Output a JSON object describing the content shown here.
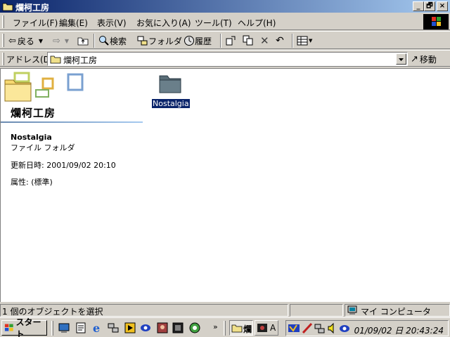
{
  "window": {
    "title": "爛柯工房"
  },
  "caption_buttons": {
    "minimize": "_",
    "maximize": "🗗",
    "close": "×"
  },
  "menu": [
    "ファイル(F)",
    "編集(E)",
    "表示(V)",
    "お気に入り(A)",
    "ツール(T)",
    "ヘルプ(H)"
  ],
  "toolbar": {
    "back_label": "戻る",
    "search_label": "検索",
    "folders_label": "フォルダ",
    "history_label": "履歴"
  },
  "address": {
    "label": "アドレス(D)",
    "value": "爛柯工房",
    "go_label": "移動"
  },
  "web_panel": {
    "title": "爛柯工房",
    "selected_name": "Nostalgia",
    "selected_type": "ファイル フォルダ",
    "modified": "更新日時: 2001/09/02 20:10",
    "attributes": "属性: (標準)"
  },
  "files": [
    {
      "name": "Nostalgia",
      "icon": "folder-icon",
      "selected": true
    }
  ],
  "statusbar": {
    "count": "1 個のオブジェクトを選択",
    "zone": "マイ コンピュータ"
  },
  "taskbar": {
    "start_label": "スタート",
    "task1_label": "爛",
    "task2_label": "A",
    "clock": "01/09/02 日 20:43:24"
  },
  "colors": {
    "titlebar_start": "#0a246a",
    "titlebar_end": "#a6caf0",
    "face": "#d4d0c8",
    "selection": "#0a246a"
  }
}
